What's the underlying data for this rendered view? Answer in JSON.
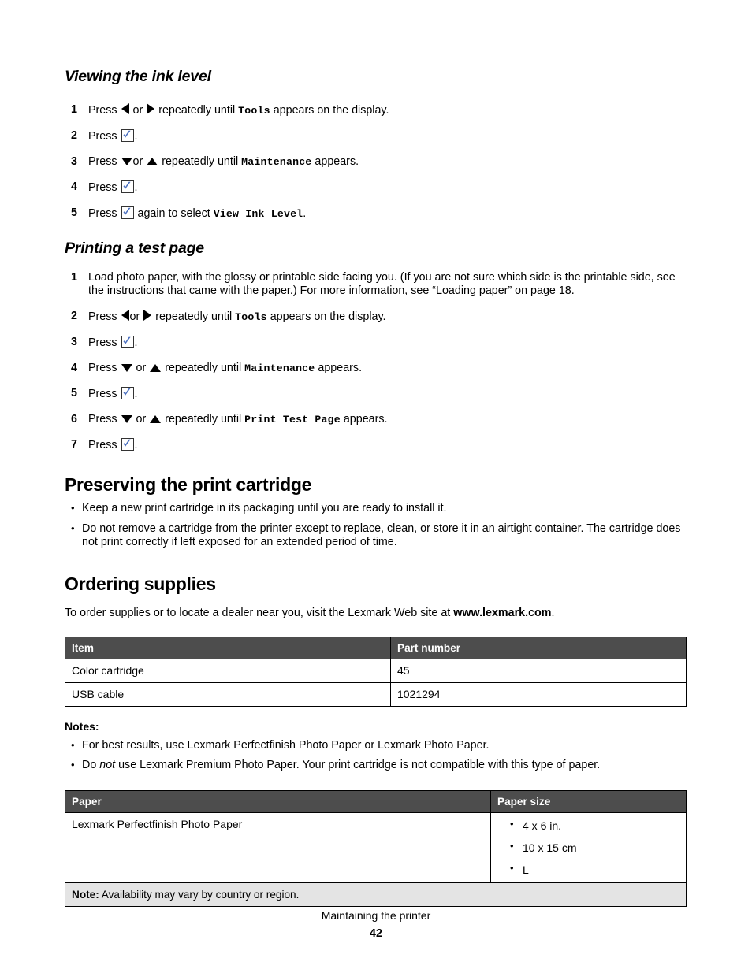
{
  "sections": {
    "viewing_ink": {
      "heading": "Viewing the ink level",
      "steps": [
        {
          "num": "1",
          "pre": "Press",
          "mid": "or",
          "post_a": "repeatedly until",
          "code": "Tools",
          "post_b": "appears on the display."
        },
        {
          "num": "2",
          "pre": "Press",
          "post_b": "."
        },
        {
          "num": "3",
          "pre": "Press",
          "mid": "or",
          "post_a": "repeatedly until",
          "code": "Maintenance",
          "post_b": "appears."
        },
        {
          "num": "4",
          "pre": "Press",
          "post_b": "."
        },
        {
          "num": "5",
          "pre": "Press",
          "post_a": "again to select",
          "code": "View Ink Level",
          "post_b": "."
        }
      ]
    },
    "printing_test": {
      "heading": "Printing a test page",
      "step1": "Load photo paper, with the glossy or printable side facing you. (If you are not sure which side is the printable side, see the instructions that came with the paper.) For more information, see “Loading paper” on page 18.",
      "steps": [
        {
          "num": "2",
          "pre": "Press",
          "mid": "or",
          "post_a": "repeatedly until",
          "code": "Tools",
          "post_b": " appears on the display."
        },
        {
          "num": "3",
          "pre": "Press",
          "post_b": "."
        },
        {
          "num": "4",
          "pre": "Press",
          "mid": "or",
          "post_a": "repeatedly until",
          "code": "Maintenance",
          "post_b": "appears."
        },
        {
          "num": "5",
          "pre": "Press",
          "post_b": "."
        },
        {
          "num": "6",
          "pre": "Press",
          "mid": "or",
          "post_a": "repeatedly until",
          "code": "Print Test Page",
          "post_b": "appears."
        },
        {
          "num": "7",
          "pre": "Press",
          "post_b": "."
        }
      ]
    },
    "preserving": {
      "heading": "Preserving the print cartridge",
      "bullets": [
        "Keep a new print cartridge in its packaging until you are ready to install it.",
        "Do not remove a cartridge from the printer except to replace, clean, or store it in an airtight container. The cartridge does not print correctly if left exposed for an extended period of time."
      ]
    },
    "ordering": {
      "heading": "Ordering supplies",
      "intro_pre": "To order supplies or to locate a dealer near you, visit the Lexmark Web site at ",
      "intro_link": "www.lexmark.com",
      "intro_post": ".",
      "supplies_table": {
        "headers": [
          "Item",
          "Part number"
        ],
        "rows": [
          [
            "Color cartridge",
            "45"
          ],
          [
            "USB cable",
            "1021294"
          ]
        ]
      },
      "notes_label": "Notes:",
      "notes": [
        {
          "plain": "For best results, use Lexmark Perfectfinish Photo Paper or Lexmark Photo Paper."
        },
        {
          "pre": "Do ",
          "em": "not",
          "post": " use Lexmark Premium Photo Paper. Your print cartridge is not compatible with this type of paper."
        }
      ],
      "paper_table": {
        "headers": [
          "Paper",
          "Paper size"
        ],
        "row_paper": "Lexmark Perfectfinish Photo Paper",
        "row_sizes": [
          "4 x 6 in.",
          "10 x 15 cm",
          "L"
        ],
        "note_label": "Note:",
        "note_text": " Availability may vary by country or region."
      }
    }
  },
  "footer": {
    "title": "Maintaining the printer",
    "page_number": "42"
  },
  "icons": {
    "left_arrow": "left-triangle-icon",
    "right_arrow": "right-triangle-icon",
    "up_arrow": "up-triangle-icon",
    "down_arrow": "down-triangle-icon",
    "select": "checkmark-button-icon"
  },
  "colors": {
    "table_header_bg": "#4d4d4d",
    "table_header_text": "#ffffff",
    "note_row_bg": "#e4e4e4",
    "checkmark_blue": "#4a6fbf",
    "page_bg": "#ffffff",
    "text": "#000000"
  }
}
